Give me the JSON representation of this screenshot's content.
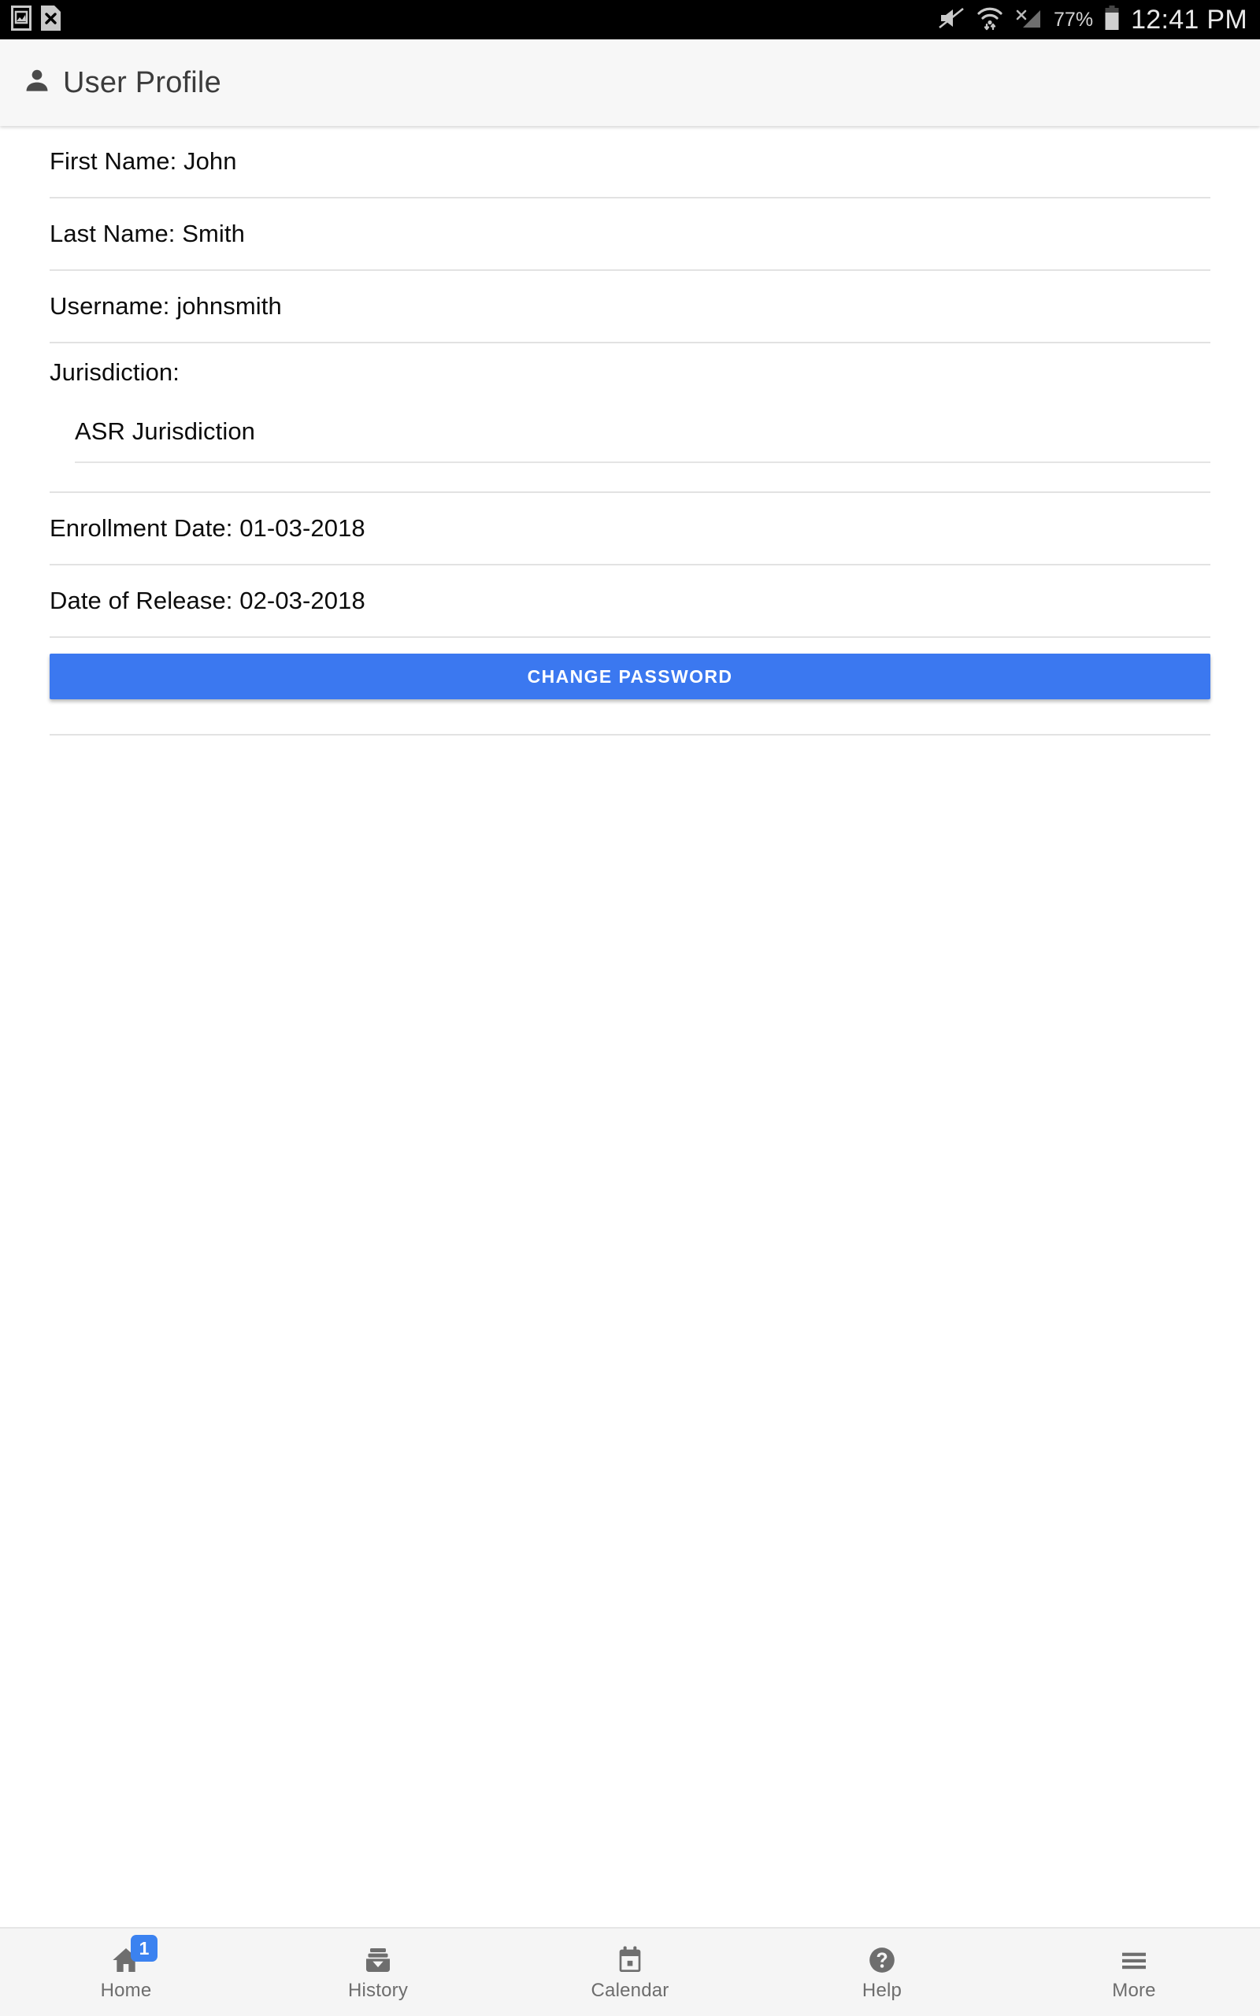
{
  "status_bar": {
    "background": "#000000",
    "notifications": [
      {
        "icon": "screenshot-image-icon"
      },
      {
        "icon": "document-error-icon"
      }
    ],
    "indicators": [
      {
        "icon": "volume-muted-icon"
      },
      {
        "icon": "wifi-transfer-icon"
      },
      {
        "icon": "cellular-no-signal-icon"
      }
    ],
    "battery_percent": "77%",
    "battery_icon": "battery-icon",
    "time": "12:41 PM"
  },
  "header": {
    "icon": "person-icon",
    "title": "User Profile",
    "background": "#F7F7F7"
  },
  "profile": {
    "fields": [
      {
        "name": "first-name",
        "text": "First Name: John"
      },
      {
        "name": "last-name",
        "text": "Last Name: Smith"
      },
      {
        "name": "username",
        "text": "Username: johnsmith"
      }
    ],
    "jurisdiction": {
      "label": "Jurisdiction:",
      "value": "ASR Jurisdiction"
    },
    "dates": [
      {
        "name": "enrollment-date",
        "text": "Enrollment Date: 01-03-2018"
      },
      {
        "name": "date-of-release",
        "text": "Date of Release: 02-03-2018"
      }
    ]
  },
  "actions": {
    "change_password_label": "CHANGE PASSWORD",
    "change_password_color": "#3B78F0"
  },
  "bottom_nav": {
    "background": "#F5F5F5",
    "badge_color": "#3B82F0",
    "items": [
      {
        "label": "Home",
        "icon": "home-icon",
        "badge": "1"
      },
      {
        "label": "History",
        "icon": "archive-icon",
        "badge": null
      },
      {
        "label": "Calendar",
        "icon": "calendar-icon",
        "badge": null
      },
      {
        "label": "Help",
        "icon": "help-circle-icon",
        "badge": null
      },
      {
        "label": "More",
        "icon": "menu-hamburger-icon",
        "badge": null
      }
    ]
  }
}
